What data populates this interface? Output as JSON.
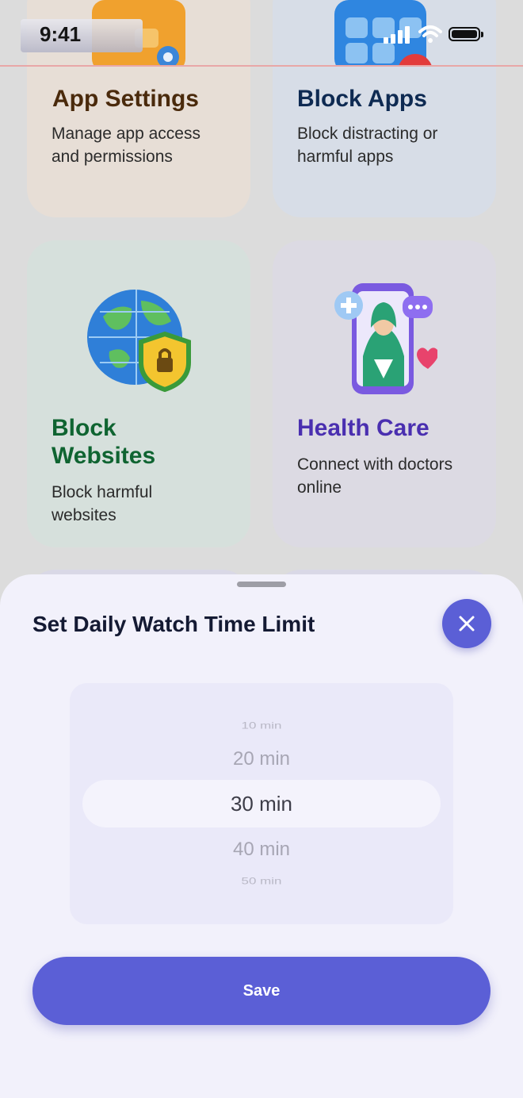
{
  "status_bar": {
    "time": "9:41"
  },
  "cards": {
    "app_settings": {
      "title": "App Settings",
      "desc_line1": "Manage app access",
      "desc_line2": "and permissions",
      "title_color": "#4a2a0c"
    },
    "block_apps": {
      "title": "Block Apps",
      "desc_line1": "Block distracting or",
      "desc_line2": "harmful apps",
      "title_color": "#0e2a52"
    },
    "block_websites": {
      "title_line1": "Block",
      "title_line2": "Websites",
      "desc_line1": "Block harmful",
      "desc_line2": "websites",
      "title_color": "#0f6431"
    },
    "health_care": {
      "title": "Health Care",
      "desc_line1": "Connect with doctors",
      "desc_line2": "online",
      "title_color": "#4a2fb0"
    }
  },
  "sheet": {
    "title": "Set Daily Watch Time Limit",
    "picker_options": [
      "10 min",
      "20 min",
      "30 min",
      "40 min",
      "50 min"
    ],
    "selected": "30 min",
    "save_label": "Save",
    "accent": "#5b5fd6"
  }
}
